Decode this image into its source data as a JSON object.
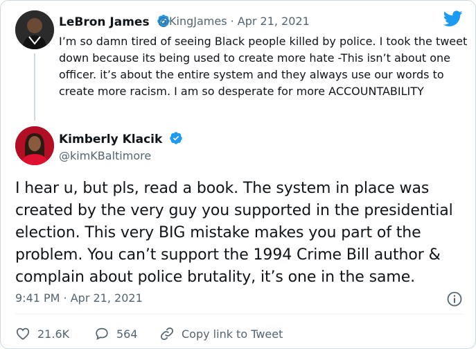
{
  "tweet_quoted": {
    "author_name": "LeBron James",
    "author_handle": "@KingJames · Apr 21, 2021",
    "text": "I’m so damn tired of seeing Black people killed by police. I took the tweet down because its being used to create more hate -This isn’t about one officer.  it’s about the entire system and they always use our words to create more racism. I am so desperate for more ACCOUNTABILITY"
  },
  "tweet_main": {
    "author_name": "Kimberly Klacik",
    "author_handle": "@kimKBaltimore",
    "text": "I hear u, but pls, read a book. The system in place was created by the very guy you supported in the presidential election. This very BIG mistake makes you part of the problem. You can’t support the 1994 Crime Bill author & complain about police brutality, it’s one in the same.",
    "timestamp": "9:41 PM · Apr 21, 2021"
  },
  "actions": {
    "likes": "21.6K",
    "replies": "564",
    "copy_link": "Copy link to Tweet"
  },
  "icons": [
    "twitter-bird-icon",
    "verified-badge-icon",
    "info-icon",
    "heart-icon",
    "reply-icon",
    "link-icon"
  ],
  "colors": {
    "brand": "#1d9bf0",
    "secondary_text": "#536471"
  }
}
